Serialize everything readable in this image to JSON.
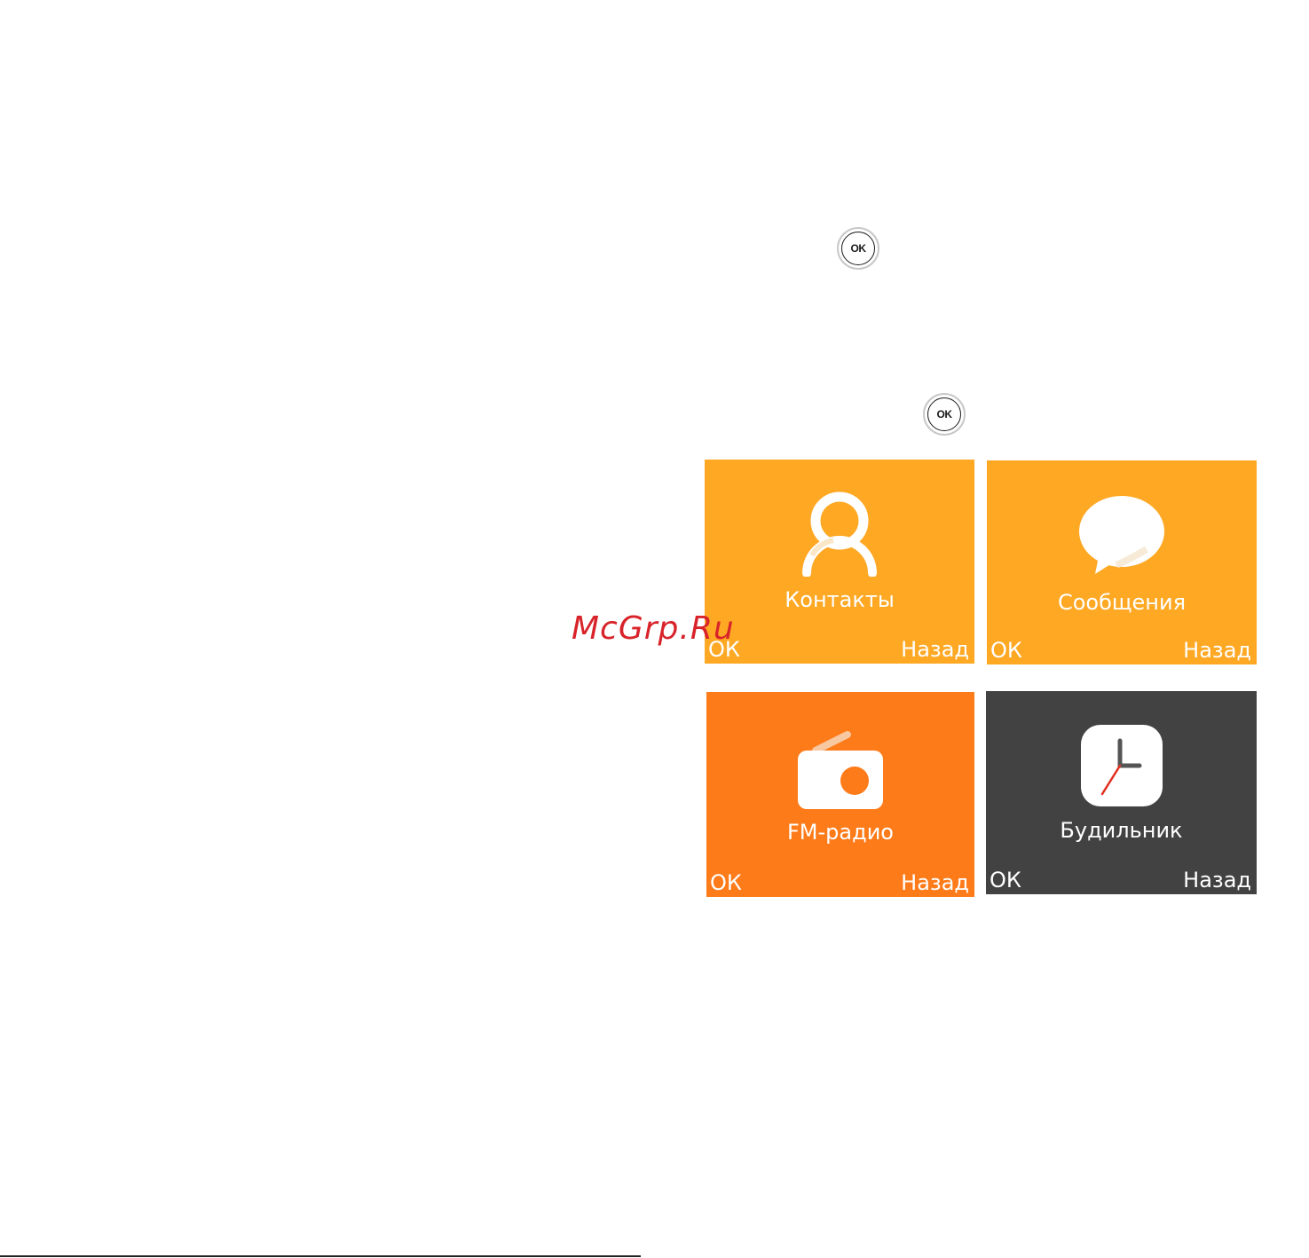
{
  "ok_keys": [
    {
      "label": "OK"
    },
    {
      "label": "OK"
    }
  ],
  "screens": [
    {
      "title": "Контакты",
      "icon": "contacts-icon",
      "bg": "#FEA824",
      "left_softkey": "ОК",
      "right_softkey": "Назад"
    },
    {
      "title": "Сообщения",
      "icon": "messages-icon",
      "bg": "#FEA824",
      "left_softkey": "ОК",
      "right_softkey": "Назад"
    },
    {
      "title": "FM-радио",
      "icon": "radio-icon",
      "bg": "#FE7B1A",
      "left_softkey": "ОК",
      "right_softkey": "Назад"
    },
    {
      "title": "Будильник",
      "icon": "alarm-clock-icon",
      "bg": "#424242",
      "left_softkey": "ОК",
      "right_softkey": "Назад"
    }
  ],
  "watermark": "McGrp.Ru"
}
